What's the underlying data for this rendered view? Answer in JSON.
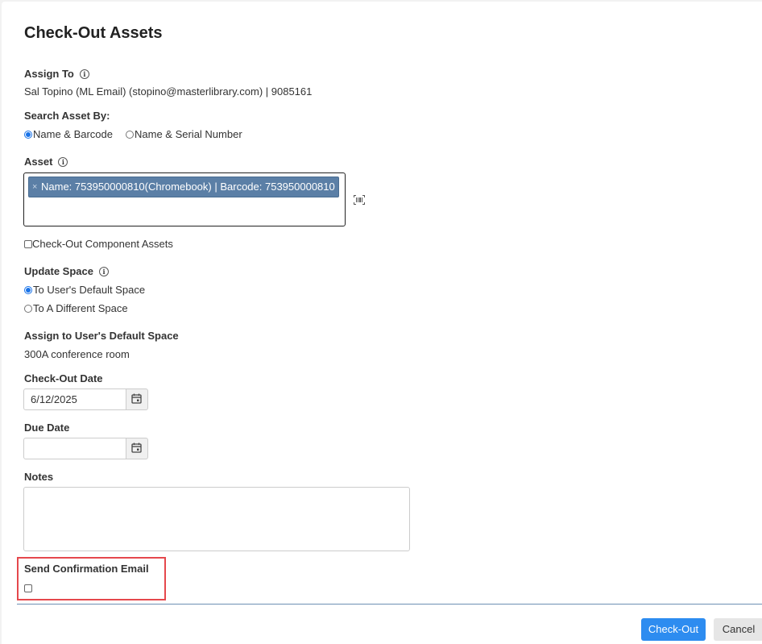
{
  "dialog": {
    "title": "Check-Out Assets"
  },
  "assign_to": {
    "label": "Assign To",
    "info_icon": "ⓘ",
    "value": "Sal Topino (ML Email) (stopino@masterlibrary.com) | 9085161"
  },
  "search_by": {
    "label": "Search Asset By:",
    "options": [
      {
        "label": "Name & Barcode",
        "checked": true
      },
      {
        "label": "Name & Serial Number",
        "checked": false
      }
    ]
  },
  "asset": {
    "label": "Asset",
    "info_icon": "ⓘ",
    "chip_remove": "×",
    "selected": "Name: 753950000810(Chromebook) | Barcode: 753950000810",
    "barcode_icon": "barcode-scan-icon"
  },
  "component_assets": {
    "label": "Check-Out Component Assets",
    "checked": false
  },
  "update_space": {
    "label": "Update Space",
    "info_icon": "ⓘ",
    "options": [
      {
        "label": "To User's Default Space",
        "checked": true
      },
      {
        "label": "To A Different Space",
        "checked": false
      }
    ]
  },
  "default_space": {
    "label": "Assign to User's Default Space",
    "value": "300A conference room"
  },
  "checkout_date": {
    "label": "Check-Out Date",
    "value": "6/12/2025",
    "calendar_icon": "calendar-icon"
  },
  "due_date": {
    "label": "Due Date",
    "value": "",
    "calendar_icon": "calendar-icon"
  },
  "notes": {
    "label": "Notes",
    "value": ""
  },
  "confirmation_email": {
    "label": "Send Confirmation Email",
    "checked": false
  },
  "footer": {
    "checkout_label": "Check-Out",
    "cancel_label": "Cancel"
  },
  "colors": {
    "primary": "#2d8cf0",
    "chip": "#5b7fa6",
    "highlight": "#e5484d"
  }
}
